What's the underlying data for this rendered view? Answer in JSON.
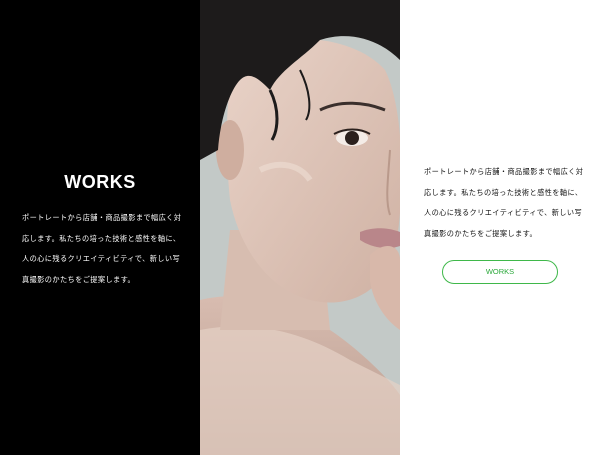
{
  "left": {
    "title": "WORKS",
    "description": "ポートレートから店舗・商品撮影まで幅広く対応します。私たちの培った技術と感性を軸に、人の心に残るクリエイティビティで、新しい写真撮影のかたちをご提案します。"
  },
  "right": {
    "description": "ポートレートから店舗・商品撮影まで幅広く対応します。私たちの培った技術と感性を軸に、人の心に残るクリエイティビティで、新しい写真撮影のかたちをご提案します。",
    "button_label": "WORKS",
    "accent_color": "#3fb84a"
  }
}
